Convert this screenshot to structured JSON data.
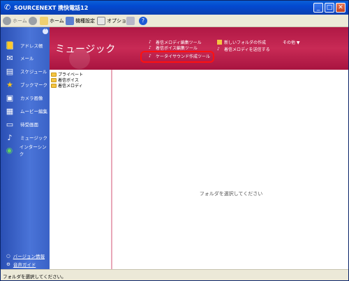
{
  "window": {
    "title": "SOURCENEXT 携快電話12",
    "controls": [
      "minimize",
      "maximize",
      "close"
    ]
  },
  "toolbar": {
    "back_label": "ホーム",
    "home_label": "ホーム",
    "settings_label": "機種設定",
    "options_label": "オプション"
  },
  "sidebar": {
    "items": [
      {
        "label": "アドレス帳",
        "icon": "address-book-icon"
      },
      {
        "label": "メール",
        "icon": "mail-icon"
      },
      {
        "label": "スケジュール",
        "icon": "schedule-icon"
      },
      {
        "label": "ブックマーク",
        "icon": "bookmark-star-icon"
      },
      {
        "label": "カメラ画像",
        "icon": "camera-icon"
      },
      {
        "label": "ムービー編集",
        "icon": "movie-icon"
      },
      {
        "label": "待受画面",
        "icon": "standby-screen-icon"
      },
      {
        "label": "ミュージック",
        "icon": "music-note-icon"
      },
      {
        "label": "インターシンク",
        "icon": "intersync-icon"
      }
    ],
    "version_link": "バージョン情報",
    "guide_link": "音声ガイド"
  },
  "banner": {
    "title": "ミュージック",
    "links": {
      "ringtone_editor": "着信メロディ編集ツール",
      "voice_editor": "着信ボイス編集ツール",
      "keitai_sound": "ケータイサウンド作成ツール",
      "new_folder": "新しいフォルダの作成",
      "send_melody": "着信メロディを送信する",
      "other": "その他 ▼"
    }
  },
  "tree": {
    "folders": [
      "プライベート",
      "着信ボイス",
      "着信メロディ"
    ]
  },
  "content": {
    "empty_message": "フォルダを選択してください"
  },
  "status": {
    "text": "フォルダを選択してください。"
  },
  "colors": {
    "banner": "#b01845",
    "sidebar": "#3a62c6",
    "highlight": "#ff1010"
  }
}
